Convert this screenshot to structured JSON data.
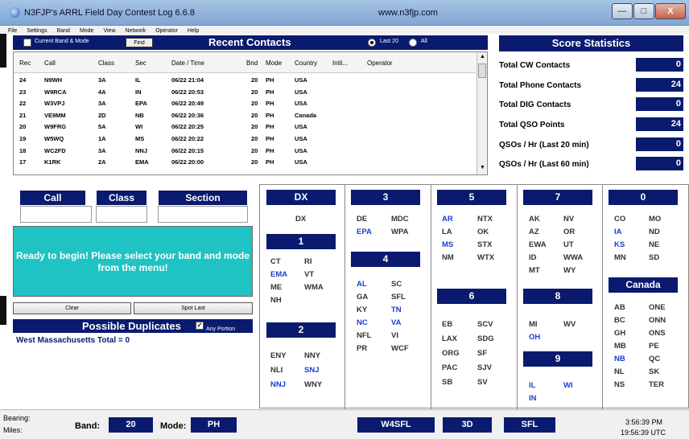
{
  "window": {
    "title": "N3FJP's ARRL Field Day Contest Log 6.6.8",
    "url": "www.n3fjp.com",
    "min": "—",
    "max": "□",
    "close": "X"
  },
  "menu": [
    "File",
    "Settings",
    "Band",
    "Mode",
    "View",
    "Network",
    "Operator",
    "Help"
  ],
  "recent": {
    "current_band_mode": "Current Band & Mode",
    "find": "Find",
    "title": "Recent Contacts",
    "last20": "Last 20",
    "all": "All"
  },
  "table": {
    "columns": [
      "Rec",
      "Call",
      "Class",
      "Sec",
      "Date  /  Time",
      "Bnd",
      "Mode",
      "Country",
      "Initi...",
      "Operator"
    ],
    "rows": [
      [
        "24",
        "N9WH",
        "3A",
        "IL",
        "06/22  21:04",
        "20",
        "PH",
        "USA"
      ],
      [
        "23",
        "W9RCA",
        "4A",
        "IN",
        "06/22  20:53",
        "20",
        "PH",
        "USA"
      ],
      [
        "22",
        "W3VPJ",
        "3A",
        "EPA",
        "06/22  20:49",
        "20",
        "PH",
        "USA"
      ],
      [
        "21",
        "VE9MM",
        "2D",
        "NB",
        "06/22  20:36",
        "20",
        "PH",
        "Canada"
      ],
      [
        "20",
        "W9FRG",
        "5A",
        "WI",
        "06/22  20:25",
        "20",
        "PH",
        "USA"
      ],
      [
        "19",
        "W5WQ",
        "1A",
        "MS",
        "06/22  20:22",
        "20",
        "PH",
        "USA"
      ],
      [
        "18",
        "WC2FD",
        "3A",
        "NNJ",
        "06/22  20:15",
        "20",
        "PH",
        "USA"
      ],
      [
        "17",
        "K1RK",
        "2A",
        "EMA",
        "06/22  20:00",
        "20",
        "PH",
        "USA"
      ]
    ]
  },
  "score": {
    "title": "Score Statistics",
    "items": [
      {
        "label": "Total CW Contacts",
        "value": "0"
      },
      {
        "label": "Total Phone Contacts",
        "value": "24"
      },
      {
        "label": "Total DIG Contacts",
        "value": "0"
      },
      {
        "label": "Total QSO Points",
        "value": "24"
      },
      {
        "label": "QSOs / Hr (Last 20 min)",
        "value": "0"
      },
      {
        "label": "QSOs / Hr (Last 60 min)",
        "value": "0"
      }
    ]
  },
  "entry": {
    "call": "Call",
    "class": "Class",
    "section": "Section",
    "message": "Ready to begin!  Please select your band and mode from the menu!",
    "clear": "Clear",
    "spot_last": "Spot Last",
    "dups_title": "Possible Duplicates",
    "any_portion": "Any Portion",
    "dups_text": "West Massachusetts   Total = 0"
  },
  "sections": {
    "dx": {
      "title": "DX",
      "items": [
        "DX"
      ]
    },
    "d1": {
      "title": "1",
      "items": [
        "CT",
        "RI",
        "EMA",
        "VT",
        "ME",
        "WMA",
        "NH"
      ]
    },
    "d2": {
      "title": "2",
      "items": [
        "ENY",
        "NNY",
        "NLI",
        "SNJ",
        "NNJ",
        "WNY"
      ]
    },
    "d3": {
      "title": "3",
      "items": [
        "DE",
        "MDC",
        "EPA",
        "WPA"
      ]
    },
    "d4": {
      "title": "4",
      "items": [
        "AL",
        "SC",
        "GA",
        "SFL",
        "KY",
        "TN",
        "NC",
        "VA",
        "NFL",
        "VI",
        "PR",
        "WCF"
      ]
    },
    "d5": {
      "title": "5",
      "items": [
        "AR",
        "NTX",
        "LA",
        "OK",
        "MS",
        "STX",
        "NM",
        "WTX"
      ]
    },
    "d6": {
      "title": "6",
      "items": [
        "EB",
        "SCV",
        "LAX",
        "SDG",
        "ORG",
        "SF",
        "PAC",
        "SJV",
        "SB",
        "SV"
      ]
    },
    "d7": {
      "title": "7",
      "items": [
        "AK",
        "NV",
        "AZ",
        "OR",
        "EWA",
        "UT",
        "ID",
        "WWA",
        "MT",
        "WY"
      ]
    },
    "d8": {
      "title": "8",
      "items": [
        "MI",
        "WV",
        "OH"
      ]
    },
    "d9": {
      "title": "9",
      "items": [
        "IL",
        "WI",
        "IN"
      ]
    },
    "d0": {
      "title": "0",
      "items": [
        "CO",
        "MO",
        "IA",
        "ND",
        "KS",
        "NE",
        "MN",
        "SD"
      ]
    },
    "canada": {
      "title": "Canada",
      "items": [
        "AB",
        "ONE",
        "BC",
        "ONN",
        "GH",
        "ONS",
        "MB",
        "PE",
        "NB",
        "QC",
        "NL",
        "SK",
        "NS",
        "TER"
      ]
    }
  },
  "bottom": {
    "bearing": "Bearing:",
    "miles": "Miles:",
    "band_label": "Band:",
    "band": "20",
    "mode_label": "Mode:",
    "mode": "PH",
    "callsign": "W4SFL",
    "class": "3D",
    "section": "SFL",
    "local_time": "3:56:39  PM",
    "utc_time": "19:56:39  UTC"
  },
  "colors": {
    "navy": "#0a1a6e",
    "teal": "#1fc3c3",
    "section_blue": "#1a3fcf"
  }
}
